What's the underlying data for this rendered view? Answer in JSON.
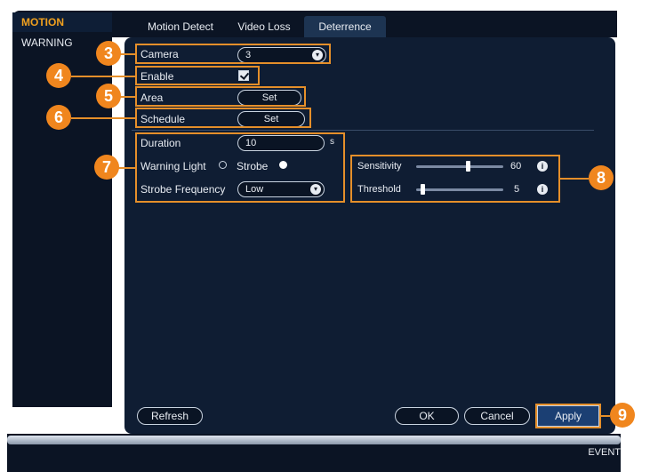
{
  "sidebar": {
    "items": [
      {
        "label": "MOTION"
      },
      {
        "label": "WARNING"
      }
    ]
  },
  "tabs": [
    {
      "label": "Motion Detect"
    },
    {
      "label": "Video Loss"
    },
    {
      "label": "Deterrence"
    }
  ],
  "form": {
    "camera": {
      "label": "Camera",
      "value": "3"
    },
    "enable": {
      "label": "Enable",
      "checked": true
    },
    "area": {
      "label": "Area",
      "button": "Set"
    },
    "schedule": {
      "label": "Schedule",
      "button": "Set"
    },
    "duration": {
      "label": "Duration",
      "value": "10",
      "unit": "s"
    },
    "warning_light": {
      "label": "Warning Light",
      "option": "Strobe",
      "selected": "Strobe"
    },
    "strobe_frequency": {
      "label": "Strobe Frequency",
      "value": "Low"
    },
    "sensitivity": {
      "label": "Sensitivity",
      "value": "60",
      "level": 0.6
    },
    "threshold": {
      "label": "Threshold",
      "value": "5",
      "level": 0.05
    }
  },
  "buttons": {
    "refresh": "Refresh",
    "ok": "OK",
    "cancel": "Cancel",
    "apply": "Apply"
  },
  "footer": {
    "label": "EVENT"
  },
  "callouts": [
    "3",
    "4",
    "5",
    "6",
    "7",
    "8",
    "9"
  ],
  "icons": {
    "dropdown": "chevron-down-icon",
    "info": "info-icon",
    "check": "check-icon"
  },
  "colors": {
    "accent": "#e58f2a",
    "marker": "#f0861e",
    "panel": "#0f1d33",
    "active_tab": "#1d3452"
  }
}
